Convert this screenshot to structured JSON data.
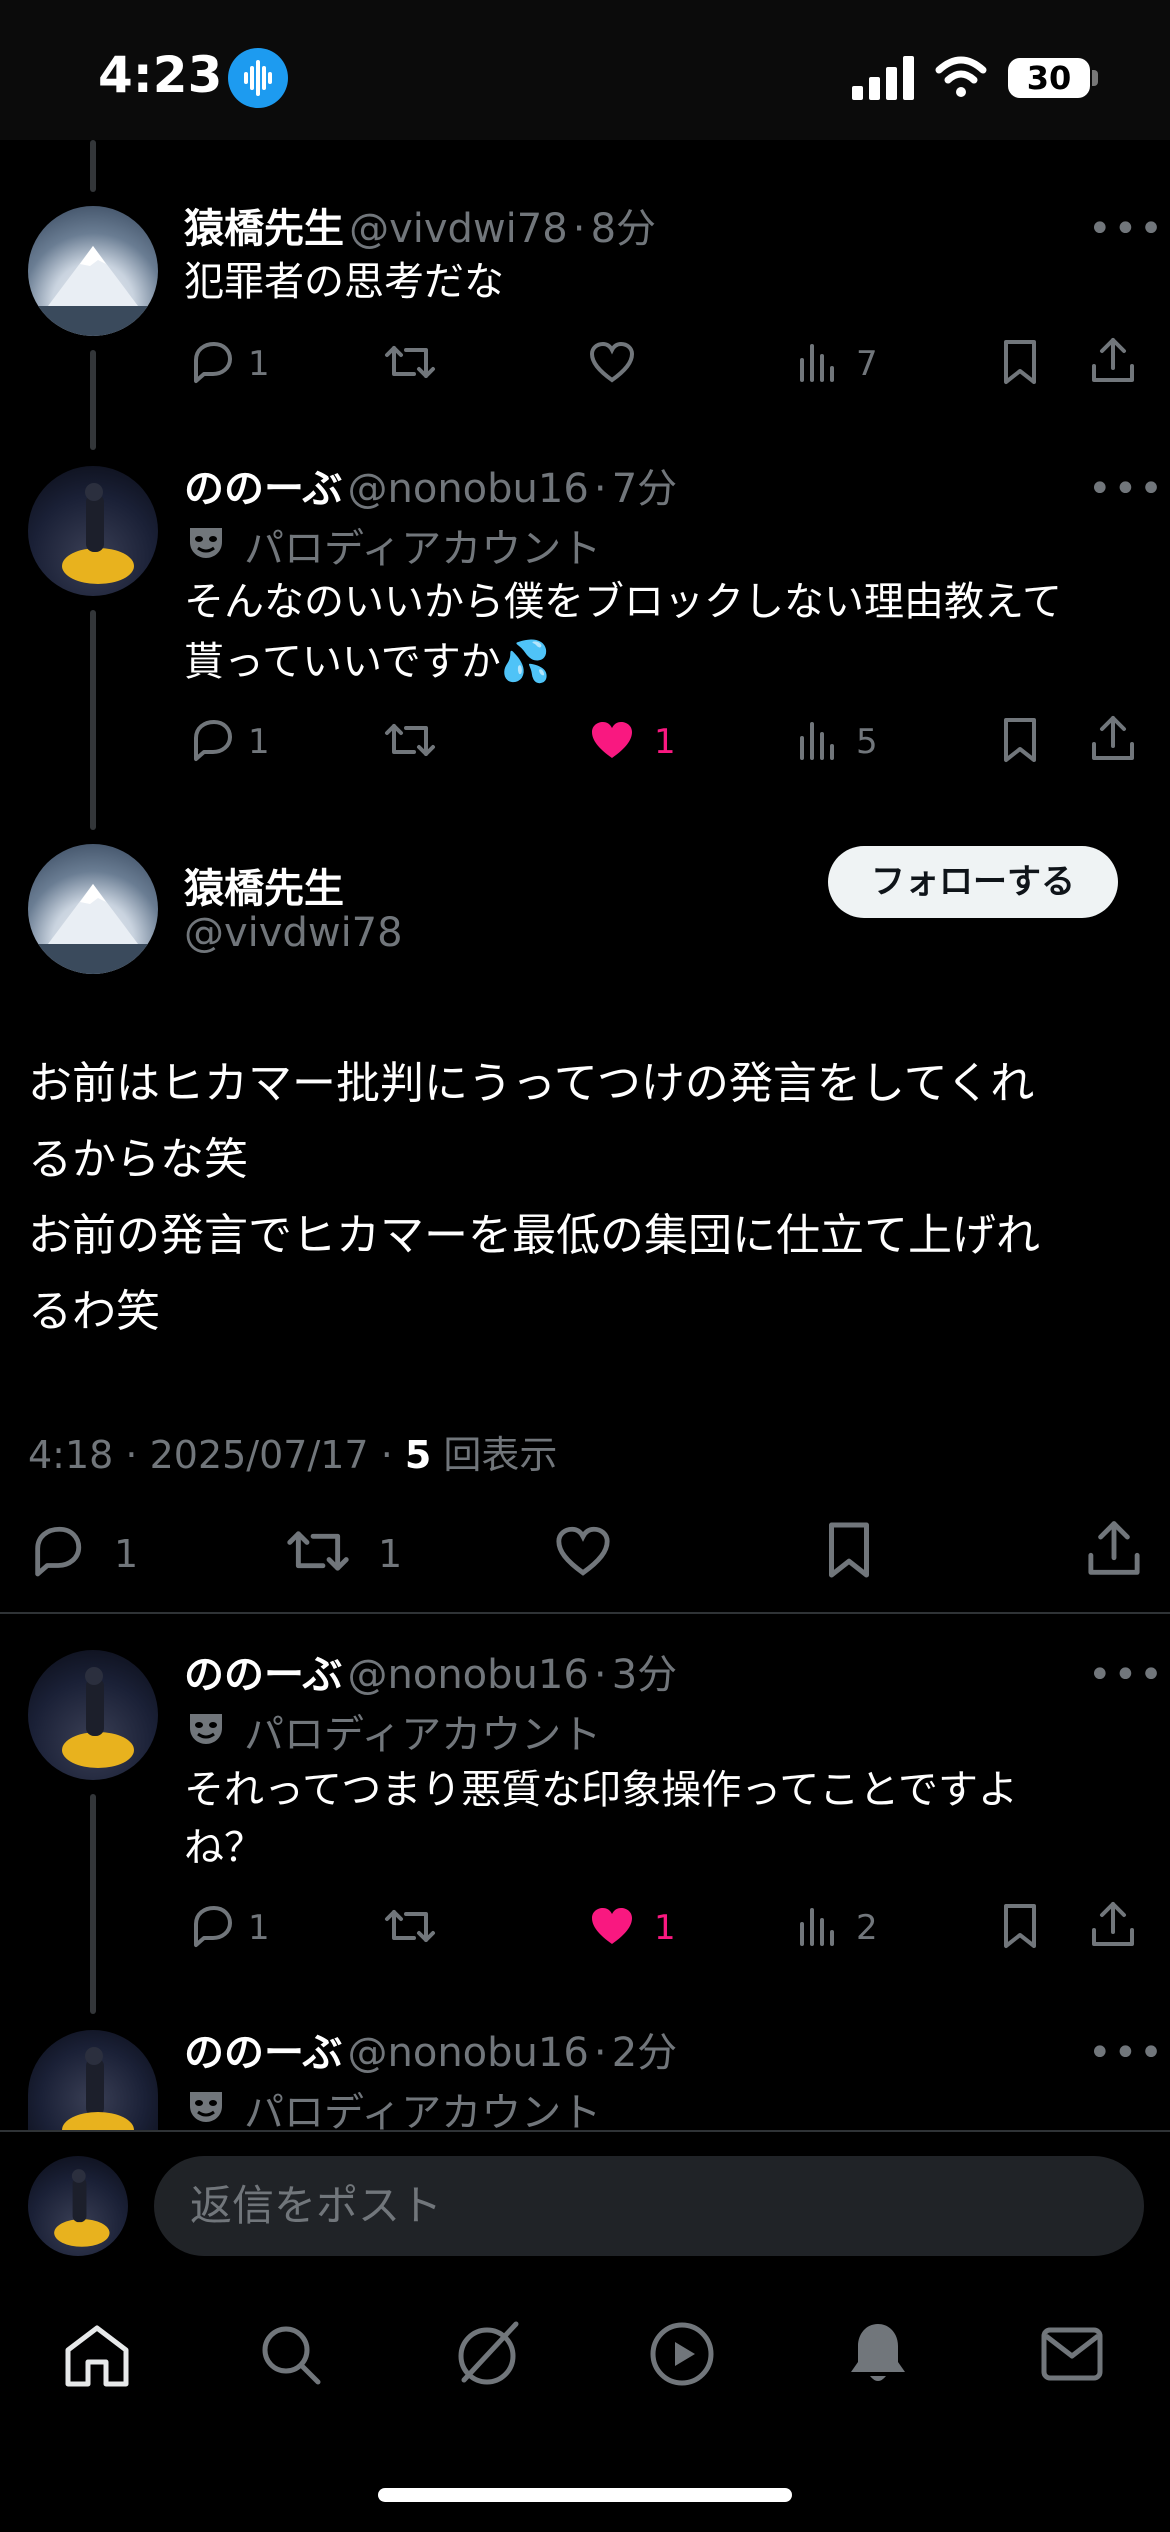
{
  "status_bar": {
    "time": "4:23",
    "battery": "30"
  },
  "replies_above": [
    {
      "name": "猿橋先生",
      "handle": "@vivdwi78",
      "sep": "·",
      "age": "8分",
      "text": "犯罪者の思考だな",
      "replies": "1",
      "views": "7"
    },
    {
      "name": "ののーぶ",
      "handle": "@nonobu16",
      "sep": "·",
      "age": "7分",
      "parody": "パロディアカウント",
      "text_line1": "そんなのいいから僕をブロックしない理由教えて",
      "text_line2": "貰っていいですか💦",
      "replies": "1",
      "likes": "1",
      "views": "5"
    }
  ],
  "main_post": {
    "name": "猿橋先生",
    "handle": "@vivdwi78",
    "follow_label": "フォローする",
    "line1": "お前はヒカマー批判にうってつけの発言をしてくれ",
    "line2": "るからな笑",
    "line3": "お前の発言でヒカマーを最低の集団に仕立て上げれ",
    "line4": "るわ笑",
    "time": "4:18",
    "date": "2025/07/17",
    "views_count": "5",
    "views_label": "回表示",
    "reply_count": "1",
    "repost_count": "1"
  },
  "replies_below": [
    {
      "name": "ののーぶ",
      "handle": "@nonobu16",
      "sep": "·",
      "age": "3分",
      "parody": "パロディアカウント",
      "text_line1": "それってつまり悪質な印象操作ってことですよ",
      "text_line2": "ね？",
      "replies": "1",
      "likes": "1",
      "views": "2"
    },
    {
      "name": "ののーぶ",
      "handle": "@nonobu16",
      "sep": "·",
      "age": "2分",
      "parody": "パロディアカウント"
    }
  ],
  "reply_bar": {
    "placeholder": "返信をポスト"
  },
  "colors": {
    "like_pink": "#f91880",
    "accent_blue": "#1d9bf0",
    "muted": "#71767b",
    "follow_bg": "#eff3f4"
  },
  "icons": [
    "reply-icon",
    "repost-icon",
    "like-icon",
    "views-icon",
    "bookmark-icon",
    "share-icon",
    "home-icon",
    "search-icon",
    "grok-icon",
    "video-icon",
    "bell-icon",
    "mail-icon"
  ]
}
